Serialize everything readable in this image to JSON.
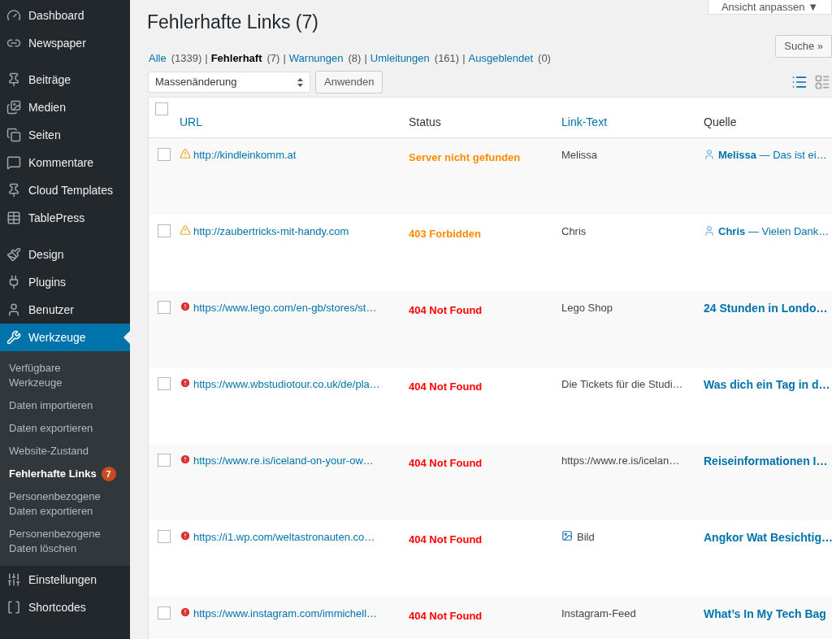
{
  "sidebar": {
    "groups": [
      [
        {
          "label": "Dashboard",
          "selected": false
        },
        {
          "label": "Newspaper",
          "selected": false
        }
      ],
      [
        {
          "label": "Beiträge",
          "selected": false
        },
        {
          "label": "Medien",
          "selected": false
        },
        {
          "label": "Seiten",
          "selected": false
        },
        {
          "label": "Kommentare",
          "selected": false
        },
        {
          "label": "Cloud Templates",
          "selected": false
        },
        {
          "label": "TablePress",
          "selected": false
        }
      ],
      [
        {
          "label": "Design",
          "selected": false
        },
        {
          "label": "Plugins",
          "selected": false
        },
        {
          "label": "Benutzer",
          "selected": false
        },
        {
          "label": "Werkzeuge",
          "selected": true,
          "submenu": [
            {
              "label": "Verfügbare Werkzeuge",
              "selected": false
            },
            {
              "label": "Daten importieren",
              "selected": false
            },
            {
              "label": "Daten exportieren",
              "selected": false
            },
            {
              "label": "Website-Zustand",
              "selected": false
            },
            {
              "label": "Fehlerhafte Links",
              "selected": true,
              "badge": "7"
            },
            {
              "label": "Personenbezogene Daten exportieren",
              "selected": false
            },
            {
              "label": "Personenbezogene Daten löschen",
              "selected": false
            }
          ]
        },
        {
          "label": "Einstellungen",
          "selected": false
        },
        {
          "label": "Shortcodes",
          "selected": false
        }
      ]
    ]
  },
  "screen_options": "Ansicht anpassen ▼",
  "title": "Fehlerhafte Links (7)",
  "filters": [
    {
      "label": "Alle",
      "count": "(1339)",
      "selected": false
    },
    {
      "separator": "|",
      "label": "Fehlerhaft",
      "count": "(7)",
      "selected": true
    },
    {
      "separator": "|",
      "label": "Warnungen",
      "count": "(8)",
      "selected": false
    },
    {
      "separator": "|",
      "label": "Umleitungen",
      "count": "(161)",
      "selected": false
    },
    {
      "separator": "|",
      "label": "Ausgeblendet",
      "count": "(0)",
      "selected": false
    }
  ],
  "search_button": "Suche »",
  "bulk_action": {
    "value": "Massenänderung"
  },
  "apply_button": "Anwenden",
  "view_modes": [
    {
      "kind": "list",
      "selected": true
    },
    {
      "kind": "excerpt",
      "selected": false
    }
  ],
  "table": {
    "select_all_checked": false,
    "columns": [
      {
        "label": "URL",
        "sortable": true
      },
      {
        "label": "Status",
        "sortable": false
      },
      {
        "label": "Link-Text",
        "sortable": true
      },
      {
        "label": "Quelle",
        "sortable": false
      }
    ],
    "rows": [
      {
        "kind": "warning",
        "checked": false,
        "url": "http://kindleinkomm.at",
        "status": "Server nicht gefunden",
        "link_text": {
          "kind": "text",
          "text": "Melissa"
        },
        "source": {
          "kind": "comment",
          "text": "**Melissa** — Das ist ei…"
        }
      },
      {
        "kind": "warning",
        "checked": false,
        "url": "http://zaubertricks-mit-handy.com",
        "status": "403 Forbidden",
        "link_text": {
          "kind": "text",
          "text": "Chris"
        },
        "source": {
          "kind": "comment",
          "text": "**Chris** — Vielen Dank…"
        }
      },
      {
        "kind": "error",
        "checked": false,
        "url": "https://www.lego.com/en-gb/stores/st…",
        "status": "404 Not Found",
        "link_text": {
          "kind": "text",
          "text": "Lego Shop"
        },
        "source": {
          "kind": "post",
          "text": "24 Stunden in Londo…"
        }
      },
      {
        "kind": "error",
        "checked": false,
        "url": "https://www.wbstudiotour.co.uk/de/pla…",
        "status": "404 Not Found",
        "link_text": {
          "kind": "text",
          "text": "Die Tickets für die Studi…"
        },
        "source": {
          "kind": "post",
          "text": "Was dich ein Tag in d…"
        }
      },
      {
        "kind": "error",
        "checked": false,
        "url": "https://www.re.is/iceland-on-your-ow…",
        "status": "404 Not Found",
        "link_text": {
          "kind": "text",
          "text": "https://www.re.is/icelan…"
        },
        "source": {
          "kind": "post",
          "text": "Reiseinformationen I…"
        }
      },
      {
        "kind": "error",
        "checked": false,
        "url": "https://i1.wp.com/weltastronauten.co…",
        "status": "404 Not Found",
        "link_text": {
          "kind": "image",
          "text": "Bild"
        },
        "source": {
          "kind": "post",
          "text": "Angkor Wat Besichtig…"
        }
      },
      {
        "kind": "error",
        "checked": false,
        "url": "https://www.instagram.com/immichell…",
        "status": "404 Not Found",
        "link_text": {
          "kind": "text",
          "text": "Instagram-Feed"
        },
        "source": {
          "kind": "post",
          "text": "What’s In My Tech Bag"
        }
      }
    ]
  }
}
